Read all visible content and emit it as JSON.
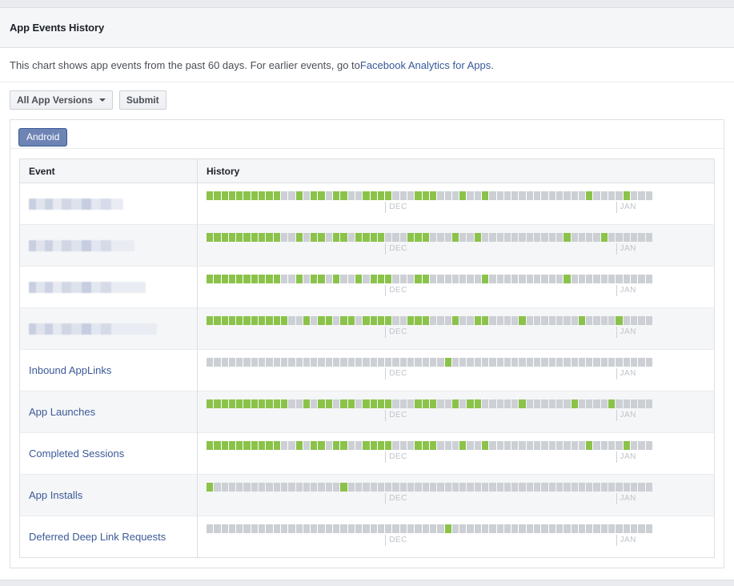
{
  "header": {
    "title": "App Events History"
  },
  "description": {
    "before": "This chart shows app events from the past 60 days. For earlier events, go to ",
    "link": "Facebook Analytics for Apps",
    "after": "."
  },
  "toolbar": {
    "version_filter_label": "All App Versions",
    "submit_label": "Submit"
  },
  "tabs": [
    {
      "label": "Android",
      "active": true
    }
  ],
  "table": {
    "columns": [
      "Event",
      "History"
    ],
    "months": [
      {
        "label": "DEC",
        "index": 24
      },
      {
        "label": "JAN",
        "index": 55
      }
    ],
    "legend": {
      "active_color": "#8bc34a",
      "inactive_color": "#ccd0d5"
    },
    "rows": [
      {
        "event": "",
        "redacted": true,
        "history": [
          1,
          1,
          1,
          1,
          1,
          1,
          1,
          1,
          1,
          1,
          0,
          0,
          1,
          0,
          1,
          1,
          0,
          1,
          1,
          0,
          0,
          1,
          1,
          1,
          1,
          0,
          0,
          0,
          1,
          1,
          1,
          0,
          0,
          0,
          1,
          0,
          0,
          1,
          0,
          0,
          0,
          0,
          0,
          0,
          0,
          0,
          0,
          0,
          0,
          0,
          0,
          1,
          0,
          0,
          0,
          0,
          1,
          0,
          0,
          0
        ]
      },
      {
        "event": "",
        "redacted": true,
        "history": [
          1,
          1,
          1,
          1,
          1,
          1,
          1,
          1,
          1,
          1,
          0,
          0,
          1,
          0,
          1,
          1,
          0,
          1,
          1,
          0,
          1,
          1,
          1,
          1,
          0,
          0,
          0,
          1,
          1,
          1,
          0,
          0,
          0,
          1,
          0,
          0,
          1,
          0,
          0,
          0,
          0,
          0,
          0,
          0,
          0,
          0,
          0,
          0,
          1,
          0,
          0,
          0,
          0,
          1,
          0,
          0,
          0,
          0,
          0,
          0
        ]
      },
      {
        "event": "",
        "redacted": true,
        "history": [
          1,
          1,
          1,
          1,
          1,
          1,
          1,
          1,
          1,
          1,
          0,
          0,
          1,
          0,
          1,
          1,
          0,
          1,
          0,
          0,
          1,
          0,
          1,
          1,
          1,
          0,
          0,
          0,
          1,
          1,
          0,
          0,
          0,
          0,
          0,
          0,
          0,
          1,
          0,
          0,
          0,
          0,
          0,
          0,
          0,
          0,
          0,
          0,
          1,
          0,
          0,
          0,
          0,
          0,
          0,
          0,
          0,
          0,
          0,
          0
        ]
      },
      {
        "event": "",
        "redacted": true,
        "history": [
          1,
          1,
          1,
          1,
          1,
          1,
          1,
          1,
          1,
          1,
          1,
          0,
          0,
          1,
          0,
          1,
          1,
          0,
          1,
          1,
          0,
          1,
          1,
          1,
          1,
          0,
          0,
          1,
          1,
          1,
          0,
          0,
          0,
          1,
          0,
          0,
          1,
          1,
          0,
          0,
          0,
          0,
          1,
          0,
          0,
          0,
          0,
          0,
          0,
          0,
          1,
          0,
          0,
          0,
          0,
          1,
          0,
          0,
          0,
          0
        ]
      },
      {
        "event": "Inbound AppLinks",
        "redacted": false,
        "history": [
          0,
          0,
          0,
          0,
          0,
          0,
          0,
          0,
          0,
          0,
          0,
          0,
          0,
          0,
          0,
          0,
          0,
          0,
          0,
          0,
          0,
          0,
          0,
          0,
          0,
          0,
          0,
          0,
          0,
          0,
          0,
          0,
          1,
          0,
          0,
          0,
          0,
          0,
          0,
          0,
          0,
          0,
          0,
          0,
          0,
          0,
          0,
          0,
          0,
          0,
          0,
          0,
          0,
          0,
          0,
          0,
          0,
          0,
          0,
          0
        ]
      },
      {
        "event": "App Launches",
        "redacted": false,
        "history": [
          1,
          1,
          1,
          1,
          1,
          1,
          1,
          1,
          1,
          1,
          1,
          0,
          0,
          1,
          0,
          1,
          1,
          0,
          1,
          1,
          0,
          1,
          1,
          1,
          1,
          0,
          0,
          0,
          1,
          1,
          1,
          0,
          0,
          1,
          0,
          1,
          1,
          0,
          0,
          0,
          0,
          0,
          1,
          0,
          0,
          0,
          0,
          0,
          0,
          1,
          0,
          0,
          0,
          0,
          1,
          0,
          0,
          0,
          0,
          0
        ]
      },
      {
        "event": "Completed Sessions",
        "redacted": false,
        "history": [
          1,
          1,
          1,
          1,
          1,
          1,
          1,
          1,
          1,
          1,
          0,
          0,
          1,
          0,
          1,
          1,
          0,
          1,
          1,
          0,
          0,
          1,
          1,
          1,
          1,
          0,
          0,
          0,
          1,
          1,
          1,
          0,
          0,
          0,
          1,
          0,
          0,
          1,
          0,
          0,
          0,
          0,
          0,
          0,
          0,
          0,
          0,
          0,
          0,
          0,
          0,
          1,
          0,
          0,
          0,
          0,
          1,
          0,
          0,
          0
        ]
      },
      {
        "event": "App Installs",
        "redacted": false,
        "history": [
          1,
          0,
          0,
          0,
          0,
          0,
          0,
          0,
          0,
          0,
          0,
          0,
          0,
          0,
          0,
          0,
          0,
          0,
          1,
          0,
          0,
          0,
          0,
          0,
          0,
          0,
          0,
          0,
          0,
          0,
          0,
          0,
          0,
          0,
          0,
          0,
          0,
          0,
          0,
          0,
          0,
          0,
          0,
          0,
          0,
          0,
          0,
          0,
          0,
          0,
          0,
          0,
          0,
          0,
          0,
          0,
          0,
          0,
          0,
          0
        ]
      },
      {
        "event": "Deferred Deep Link Requests",
        "redacted": false,
        "history": [
          0,
          0,
          0,
          0,
          0,
          0,
          0,
          0,
          0,
          0,
          0,
          0,
          0,
          0,
          0,
          0,
          0,
          0,
          0,
          0,
          0,
          0,
          0,
          0,
          0,
          0,
          0,
          0,
          0,
          0,
          0,
          0,
          1,
          0,
          0,
          0,
          0,
          0,
          0,
          0,
          0,
          0,
          0,
          0,
          0,
          0,
          0,
          0,
          0,
          0,
          0,
          0,
          0,
          0,
          0,
          0,
          0,
          0,
          0,
          0
        ]
      }
    ]
  }
}
